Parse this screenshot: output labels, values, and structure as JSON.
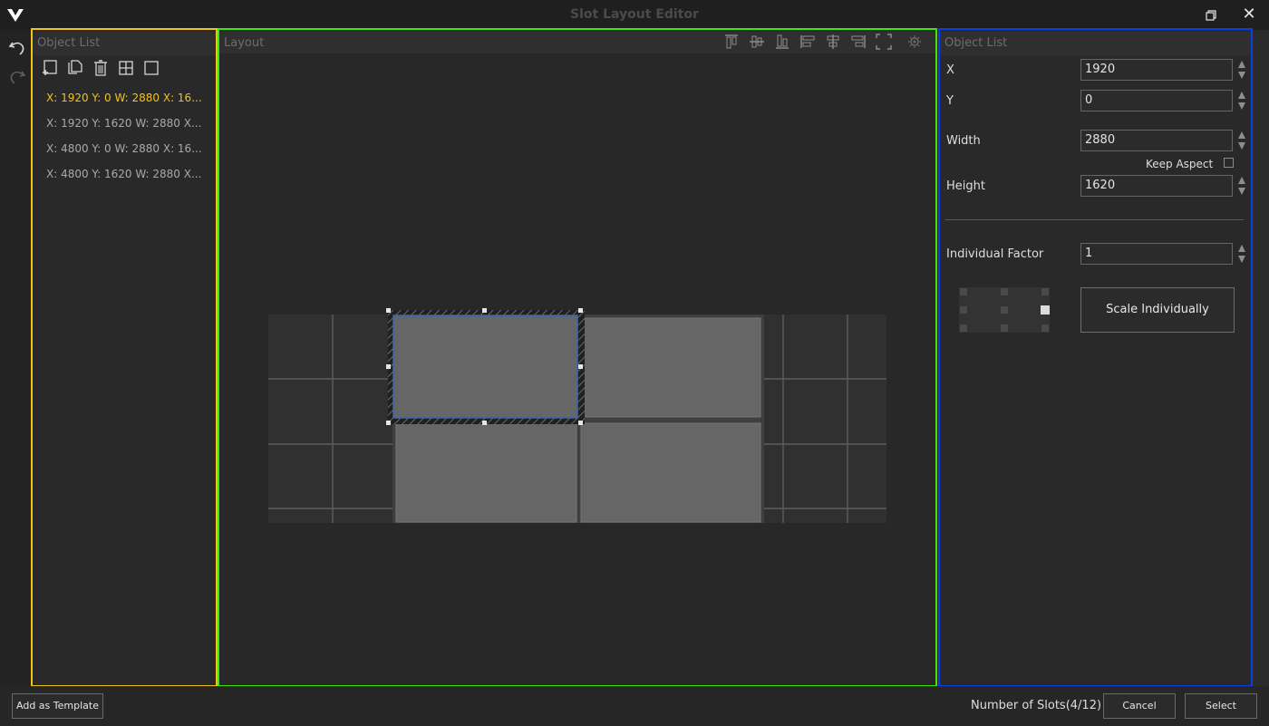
{
  "window": {
    "title": "Slot Layout Editor"
  },
  "object_panel": {
    "header": "Object List",
    "toolbar": [
      "add-object-icon",
      "copy-icon",
      "delete-icon",
      "grid-icon",
      "square-icon"
    ],
    "items": [
      {
        "label": "X: 1920 Y: 0 W: 2880 X: 16...",
        "selected": true
      },
      {
        "label": "X: 1920 Y: 1620 W: 2880 X..."
      },
      {
        "label": "X: 4800 Y: 0 W: 2880 X: 16..."
      },
      {
        "label": "X: 4800 Y: 1620 W: 2880 X..."
      }
    ]
  },
  "layout_panel": {
    "header": "Layout",
    "tools": [
      "align-top-icon",
      "align-middle-icon",
      "align-bottom-icon",
      "align-left-icon",
      "align-center-icon",
      "align-right-icon",
      "fit-view-icon",
      "settings-icon"
    ]
  },
  "props_panel": {
    "header": "Object List",
    "x_label": "X",
    "x_value": "1920",
    "y_label": "Y",
    "y_value": "0",
    "width_label": "Width",
    "width_value": "2880",
    "keep_aspect_label": "Keep Aspect",
    "keep_aspect_checked": false,
    "height_label": "Height",
    "height_value": "1620",
    "factor_label": "Individual Factor",
    "factor_value": "1",
    "scale_button": "Scale Individually"
  },
  "bottom": {
    "add_template": "Add as Template",
    "slots": "Number of Slots(4/12)",
    "cancel": "Cancel",
    "select": "Select"
  },
  "colors": {
    "object_border": "#f3c11b",
    "layout_border": "#3ee60a",
    "props_border": "#0a3ee6",
    "selected_item": "#f3c11b"
  }
}
